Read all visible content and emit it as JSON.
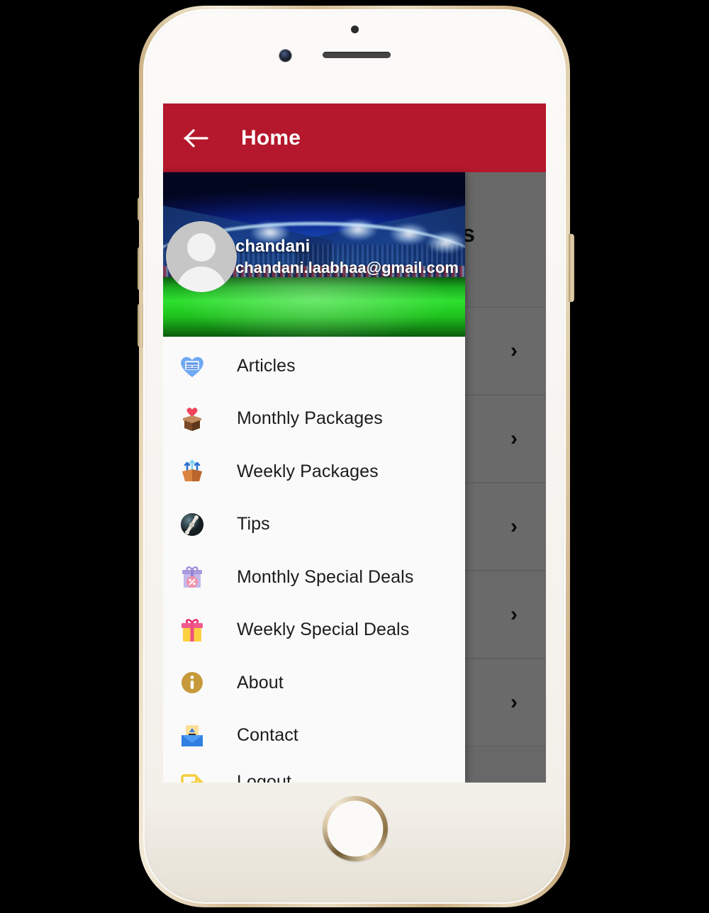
{
  "theme": {
    "accent": "#b5182c",
    "drawer_bg": "#fafafa",
    "dim_overlay": "rgba(0,0,0,0.32)"
  },
  "appbar": {
    "back_icon": "back-arrow-icon",
    "title": "Home"
  },
  "profile": {
    "avatar_icon": "default-user-avatar",
    "name": "chandani",
    "email": "chandani.laabhaa@gmail.com"
  },
  "menu": {
    "items": [
      {
        "label": "Articles",
        "icon": "blue-heart-article-icon"
      },
      {
        "label": "Monthly Packages",
        "icon": "heart-in-box-icon"
      },
      {
        "label": "Weekly Packages",
        "icon": "open-box-arrows-icon"
      },
      {
        "label": "Tips",
        "icon": "dark-circle-bone-icon"
      },
      {
        "label": "Monthly Special Deals",
        "icon": "purple-gift-percent-icon"
      },
      {
        "label": "Weekly Special Deals",
        "icon": "yellow-gift-icon"
      },
      {
        "label": "About",
        "icon": "gold-info-circle-icon"
      },
      {
        "label": "Contact",
        "icon": "blue-envelope-icon"
      },
      {
        "label": "Logout",
        "icon": "yellow-logout-icon"
      }
    ]
  },
  "background_page": {
    "partial_title": "s",
    "rows": [
      {
        "chevron": "›"
      },
      {
        "chevron": "›"
      },
      {
        "chevron": "›"
      },
      {
        "chevron": "›"
      },
      {
        "chevron": "›"
      }
    ]
  },
  "device": {
    "name": "iphone-gold-white",
    "home_button": "home-button",
    "front_camera": "front-camera",
    "earpiece": "earpiece-speaker",
    "proximity_sensor": "proximity-sensor"
  }
}
